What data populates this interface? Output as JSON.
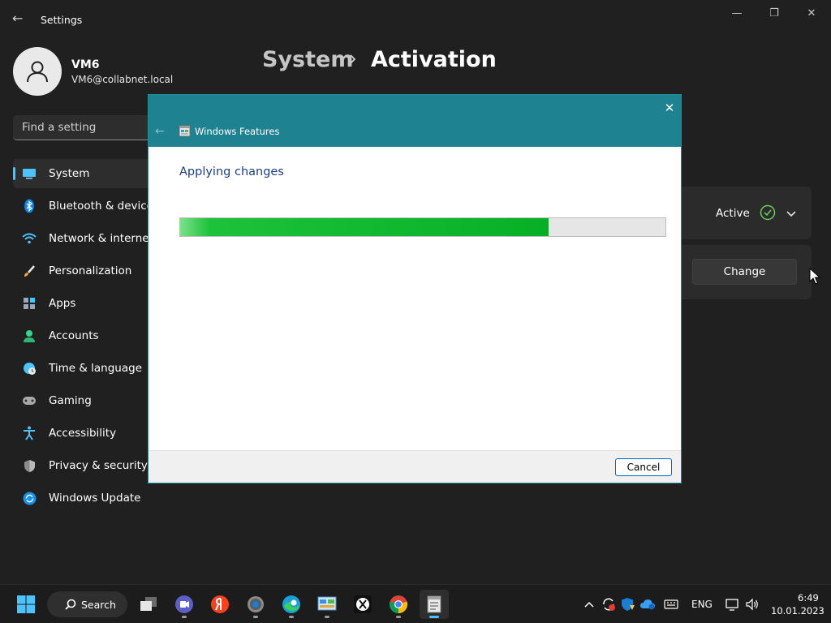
{
  "window": {
    "app_title": "Settings",
    "back_glyph": "←",
    "minimize_glyph": "—",
    "maximize_glyph": "❐",
    "close_glyph": "✕"
  },
  "profile": {
    "name": "VM6",
    "email": "VM6@collabnet.local"
  },
  "search": {
    "placeholder": "Find a setting"
  },
  "sidebar": {
    "items": [
      {
        "label": "System",
        "icon": "monitor-icon",
        "selected": true
      },
      {
        "label": "Bluetooth & devices",
        "icon": "bluetooth-icon"
      },
      {
        "label": "Network & internet",
        "icon": "wifi-icon"
      },
      {
        "label": "Personalization",
        "icon": "brush-icon"
      },
      {
        "label": "Apps",
        "icon": "apps-icon"
      },
      {
        "label": "Accounts",
        "icon": "person-icon"
      },
      {
        "label": "Time & language",
        "icon": "globe-clock-icon"
      },
      {
        "label": "Gaming",
        "icon": "gamepad-icon"
      },
      {
        "label": "Accessibility",
        "icon": "accessibility-icon"
      },
      {
        "label": "Privacy & security",
        "icon": "shield-icon"
      },
      {
        "label": "Windows Update",
        "icon": "update-icon"
      }
    ]
  },
  "header": {
    "parent": "System",
    "title": "Activation"
  },
  "activation": {
    "state": "Active",
    "change_label": "Change"
  },
  "dialog": {
    "title": "Windows Features",
    "status": "Applying changes",
    "progress_percent": 76,
    "cancel_label": "Cancel",
    "close_glyph": "✕",
    "back_glyph": "←"
  },
  "taskbar": {
    "search_label": "Search",
    "language": "ENG",
    "time": "6:49",
    "date": "10.01.2023",
    "apps": [
      "file-explorer-icon",
      "teams-icon",
      "yandex-browser-icon",
      "settings-gear-icon",
      "edge-icon",
      "control-panel-icon",
      "xhost-icon",
      "chrome-icon",
      "windows-features-icon"
    ]
  },
  "colors": {
    "accent": "#4cc2ff",
    "dialog_header": "#1e8291",
    "progress_green": "#06b025",
    "active_check": "#6ccb5f"
  }
}
